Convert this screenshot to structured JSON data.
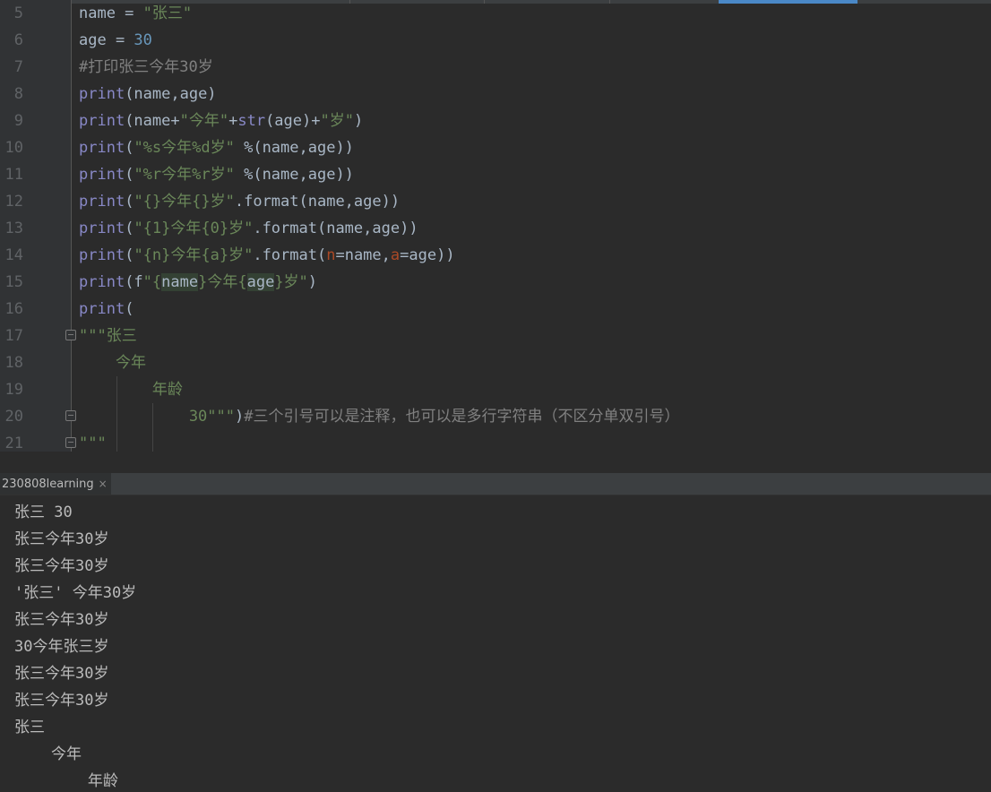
{
  "editor": {
    "lines": [
      {
        "no": "5",
        "segments": [
          {
            "t": "name = ",
            "c": ""
          },
          {
            "t": "\"张三\"",
            "c": "str"
          }
        ]
      },
      {
        "no": "6",
        "segments": [
          {
            "t": "age = ",
            "c": ""
          },
          {
            "t": "30",
            "c": "num"
          }
        ]
      },
      {
        "no": "7",
        "segments": [
          {
            "t": "#打印张三今年30岁",
            "c": "cmt"
          }
        ]
      },
      {
        "no": "8",
        "segments": [
          {
            "t": "print",
            "c": "kw-fn"
          },
          {
            "t": "(name,age)",
            "c": ""
          }
        ]
      },
      {
        "no": "9",
        "segments": [
          {
            "t": "print",
            "c": "kw-fn"
          },
          {
            "t": "(name+",
            "c": ""
          },
          {
            "t": "\"今年\"",
            "c": "str"
          },
          {
            "t": "+",
            "c": ""
          },
          {
            "t": "str",
            "c": "kw-fn"
          },
          {
            "t": "(age)+",
            "c": ""
          },
          {
            "t": "\"岁\"",
            "c": "str"
          },
          {
            "t": ")",
            "c": ""
          }
        ]
      },
      {
        "no": "10",
        "segments": [
          {
            "t": "print",
            "c": "kw-fn"
          },
          {
            "t": "(",
            "c": ""
          },
          {
            "t": "\"%s今年%d岁\"",
            "c": "str"
          },
          {
            "t": " %(name,age))",
            "c": ""
          }
        ]
      },
      {
        "no": "11",
        "segments": [
          {
            "t": "print",
            "c": "kw-fn"
          },
          {
            "t": "(",
            "c": ""
          },
          {
            "t": "\"%r今年%r岁\"",
            "c": "str"
          },
          {
            "t": " %(name,age))",
            "c": ""
          }
        ]
      },
      {
        "no": "12",
        "segments": [
          {
            "t": "print",
            "c": "kw-fn"
          },
          {
            "t": "(",
            "c": ""
          },
          {
            "t": "\"{}今年{}岁\"",
            "c": "str"
          },
          {
            "t": ".format(name,age))",
            "c": ""
          }
        ]
      },
      {
        "no": "13",
        "segments": [
          {
            "t": "print",
            "c": "kw-fn"
          },
          {
            "t": "(",
            "c": ""
          },
          {
            "t": "\"{1}今年{0}岁\"",
            "c": "str"
          },
          {
            "t": ".format(name,age))",
            "c": ""
          }
        ]
      },
      {
        "no": "14",
        "segments": [
          {
            "t": "print",
            "c": "kw-fn"
          },
          {
            "t": "(",
            "c": ""
          },
          {
            "t": "\"{n}今年{a}岁\"",
            "c": "str"
          },
          {
            "t": ".format(",
            "c": ""
          },
          {
            "t": "n",
            "c": "par"
          },
          {
            "t": "=name,",
            "c": ""
          },
          {
            "t": "a",
            "c": "par"
          },
          {
            "t": "=age))",
            "c": ""
          }
        ]
      },
      {
        "no": "15",
        "segments": [
          {
            "t": "print",
            "c": "kw-fn"
          },
          {
            "t": "(f",
            "c": ""
          },
          {
            "t": "\"{",
            "c": "str"
          },
          {
            "t": "name",
            "c": "hl"
          },
          {
            "t": "}今年{",
            "c": "str"
          },
          {
            "t": "age",
            "c": "hl"
          },
          {
            "t": "}岁\"",
            "c": "str"
          },
          {
            "t": ")",
            "c": ""
          }
        ]
      },
      {
        "no": "16",
        "segments": [
          {
            "t": "print",
            "c": "kw-fn"
          },
          {
            "t": "(",
            "c": ""
          }
        ]
      },
      {
        "no": "17",
        "segments": [
          {
            "t": "\"\"\"张三",
            "c": "str"
          }
        ]
      },
      {
        "no": "18",
        "segments": [
          {
            "t": "    今年",
            "c": "str"
          }
        ]
      },
      {
        "no": "19",
        "segments": [
          {
            "t": "        年龄",
            "c": "str"
          }
        ]
      },
      {
        "no": "20",
        "segments": [
          {
            "t": "            30\"\"\"",
            "c": "str"
          },
          {
            "t": ")",
            "c": ""
          },
          {
            "t": "#三个引号可以是注释，也可以是多行字符串（不区分单双引号）",
            "c": "cmt"
          }
        ]
      },
      {
        "no": "21",
        "segments": [
          {
            "t": "\"\"\"",
            "c": "str"
          }
        ]
      }
    ]
  },
  "run_panel": {
    "tab_label": "230808learning",
    "close_glyph": "×",
    "output": [
      "张三 30",
      "张三今年30岁",
      "张三今年30岁",
      "'张三' 今年30岁",
      "张三今年30岁",
      "30今年张三岁",
      "张三今年30岁",
      "张三今年30岁",
      "张三",
      "    今年",
      "        年龄"
    ]
  }
}
